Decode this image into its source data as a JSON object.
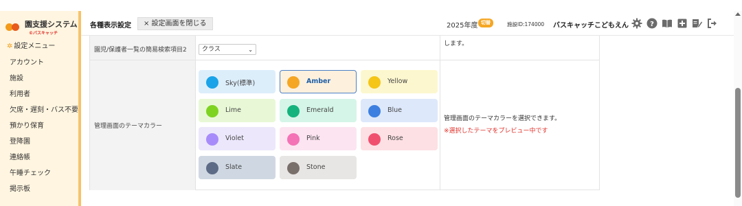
{
  "app": {
    "logo_title": "園支援システム",
    "logo_sub": "©バスキャッチ"
  },
  "sidebar": {
    "header": "設定メニュー",
    "items": [
      "アカウント",
      "施設",
      "利用者",
      "欠席・遅刻・バス不要",
      "預かり保育",
      "登降園",
      "連絡帳",
      "午睡チェック",
      "掲示板"
    ]
  },
  "header": {
    "title": "各種表示設定",
    "close_label": "× 設定画面を閉じる",
    "year": "2025年度",
    "year_badge": "切替",
    "facility_id": "施設ID:174000",
    "facility_name": "バスキャッチこどもえん",
    "icons": [
      "gear-icon",
      "help-icon",
      "book-icon",
      "plus-box-icon",
      "edit-icon",
      "logout-icon"
    ]
  },
  "settings": {
    "search_item2": {
      "label": "園児/保護者一覧の簡易検索項目2",
      "value": "クラス",
      "desc": "します。"
    },
    "theme": {
      "label": "管理画面のテーマカラー",
      "desc": "管理画面のテーマカラーを選択できます。",
      "note": "※選択したテーマをプレビュー中です",
      "selected": "Amber",
      "options": [
        {
          "name": "Sky(標準)",
          "dot": "#1aa3e8",
          "bg": "#ddeefb"
        },
        {
          "name": "Amber",
          "dot": "#f5a623",
          "bg": "#fdf1dd"
        },
        {
          "name": "Yellow",
          "dot": "#f5c518",
          "bg": "#fdf7cf"
        },
        {
          "name": "Lime",
          "dot": "#7ed321",
          "bg": "#e8f8d6"
        },
        {
          "name": "Emerald",
          "dot": "#14b37d",
          "bg": "#d5f5e8"
        },
        {
          "name": "Blue",
          "dot": "#3d7fe0",
          "bg": "#dde8fb"
        },
        {
          "name": "Violet",
          "dot": "#a78bfa",
          "bg": "#ece7fb"
        },
        {
          "name": "Pink",
          "dot": "#f472b6",
          "bg": "#fce4f1"
        },
        {
          "name": "Rose",
          "dot": "#f0506e",
          "bg": "#fde0e4"
        },
        {
          "name": "Slate",
          "dot": "#5d6b86",
          "bg": "#cfd8e2"
        },
        {
          "name": "Stone",
          "dot": "#7a706b",
          "bg": "#e8e6e4"
        }
      ]
    }
  }
}
